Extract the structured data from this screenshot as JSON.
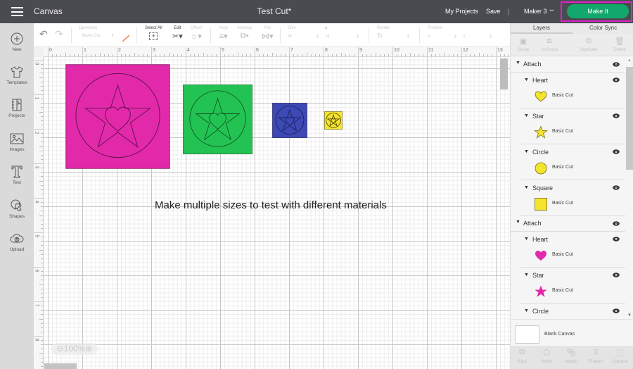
{
  "topbar": {
    "app_title": "Canvas",
    "doc_title": "Test Cut*",
    "my_projects": "My Projects",
    "save": "Save",
    "separator": "|",
    "machine": "Maker 3",
    "make_it": "Make It",
    "highlight_color": "#e01fc8",
    "make_it_color": "#13a86b"
  },
  "sidebar": {
    "items": [
      {
        "label": "New",
        "icon": "plus-circle-icon"
      },
      {
        "label": "Templates",
        "icon": "shirt-icon"
      },
      {
        "label": "Projects",
        "icon": "notebook-icon"
      },
      {
        "label": "Images",
        "icon": "image-icon"
      },
      {
        "label": "Text",
        "icon": "text-t-icon"
      },
      {
        "label": "Shapes",
        "icon": "shapes-icon"
      },
      {
        "label": "Upload",
        "icon": "cloud-upload-icon"
      }
    ]
  },
  "toolbar": {
    "undo": "↶",
    "redo": "↷",
    "operation_label": "Operation",
    "operation_value": "Basic Cut",
    "select_all": "Select All",
    "edit": "Edit",
    "offset": "Offset",
    "align": "Align",
    "arrange": "Arrange",
    "flip": "Flip",
    "size": "Size",
    "size_w": "W",
    "size_h": "H",
    "rotate": "Rotate",
    "position": "Position",
    "pos_x": "X",
    "pos_y": "Y"
  },
  "ruler": {
    "top_ticks": [
      "0",
      "1",
      "2",
      "3",
      "4",
      "5",
      "6",
      "7",
      "8",
      "9",
      "10",
      "11",
      "12",
      "13"
    ],
    "left_ticks": [
      "0",
      "1",
      "2",
      "3",
      "4",
      "5",
      "6",
      "7",
      "8"
    ]
  },
  "canvas": {
    "caption": "Make multiple sizes to test with different materials",
    "zoom_level": "100%",
    "designs": [
      {
        "name": "large",
        "color": "#e229aa"
      },
      {
        "name": "medium",
        "color": "#22c352"
      },
      {
        "name": "small",
        "color": "#3d49b4"
      },
      {
        "name": "tiny",
        "color": "#f5e42d"
      }
    ]
  },
  "panel": {
    "tabs": [
      "Layers",
      "Color Sync"
    ],
    "actions": [
      "Group",
      "UnGroup",
      "Duplicate",
      "Delete"
    ],
    "groups": [
      {
        "name": "Attach",
        "children": [
          {
            "name": "Heart",
            "op": "Basic Cut",
            "shape": "heart",
            "color": "#f5e42d"
          },
          {
            "name": "Star",
            "op": "Basic Cut",
            "shape": "star",
            "color": "#f5e42d"
          },
          {
            "name": "Circle",
            "op": "Basic Cut",
            "shape": "circle",
            "color": "#f5e42d"
          },
          {
            "name": "Square",
            "op": "Basic Cut",
            "shape": "square",
            "color": "#f5e42d"
          }
        ]
      },
      {
        "name": "Attach",
        "children": [
          {
            "name": "Heart",
            "op": "Basic Cut",
            "shape": "heart",
            "color": "#e229aa"
          },
          {
            "name": "Star",
            "op": "Basic Cut",
            "shape": "star",
            "color": "#e229aa"
          },
          {
            "name": "Circle",
            "op": "",
            "shape": "",
            "color": "#e229aa"
          }
        ]
      }
    ],
    "blank_canvas": "Blank Canvas",
    "bottom_actions": [
      "Slice",
      "Weld",
      "Attach",
      "Flatten",
      "Contour"
    ]
  }
}
